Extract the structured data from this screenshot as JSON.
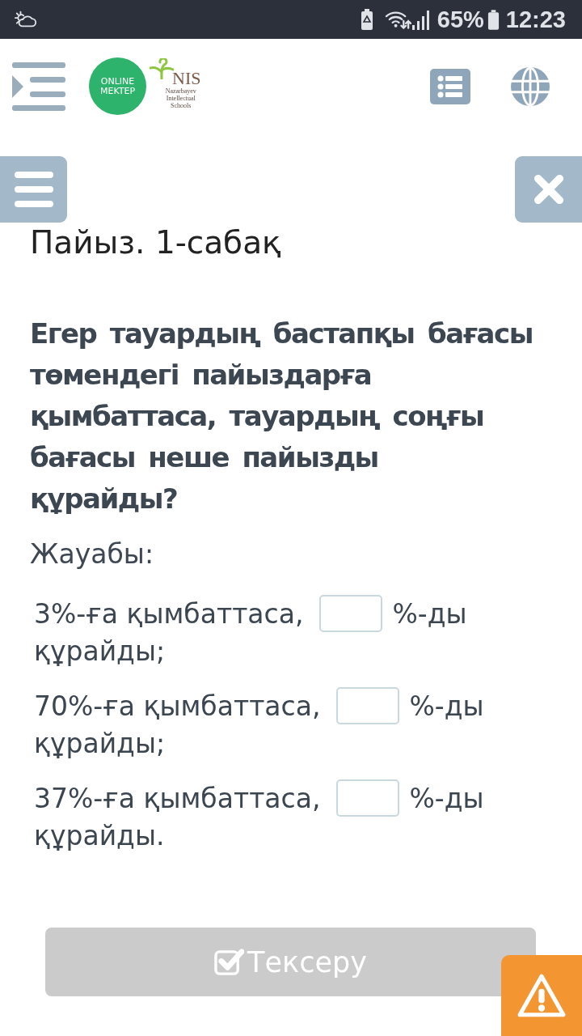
{
  "status_bar": {
    "battery": "65%",
    "time": "12:23"
  },
  "header": {
    "logo": {
      "badge_lines": [
        "ONLINE",
        "MEKTEP"
      ],
      "mark": "NIS",
      "subtitle_lines": [
        "Nazarbayev",
        "Intellectual",
        "Schools"
      ]
    }
  },
  "lesson": {
    "title": "Пайыз. 1-сабақ",
    "question": "Егер тауардың бастапқы бағасы төмендегі пайыздарға қымбаттаса, тауардың соңғы бағасы неше пайызды құрайды?",
    "answer_label": "Жауабы:",
    "answers": [
      {
        "before": "3%-ға қымбаттаса,",
        "after": "%-ды",
        "ending": "құрайды;"
      },
      {
        "before": "70%-ға қымбаттаса,",
        "after": "%-ды",
        "ending": "құрайды;"
      },
      {
        "before": "37%-ға қымбаттаса,",
        "after": "%-ды",
        "ending": "құрайды."
      }
    ]
  },
  "check_button": {
    "label": "Тексеру",
    "disabled": true
  }
}
